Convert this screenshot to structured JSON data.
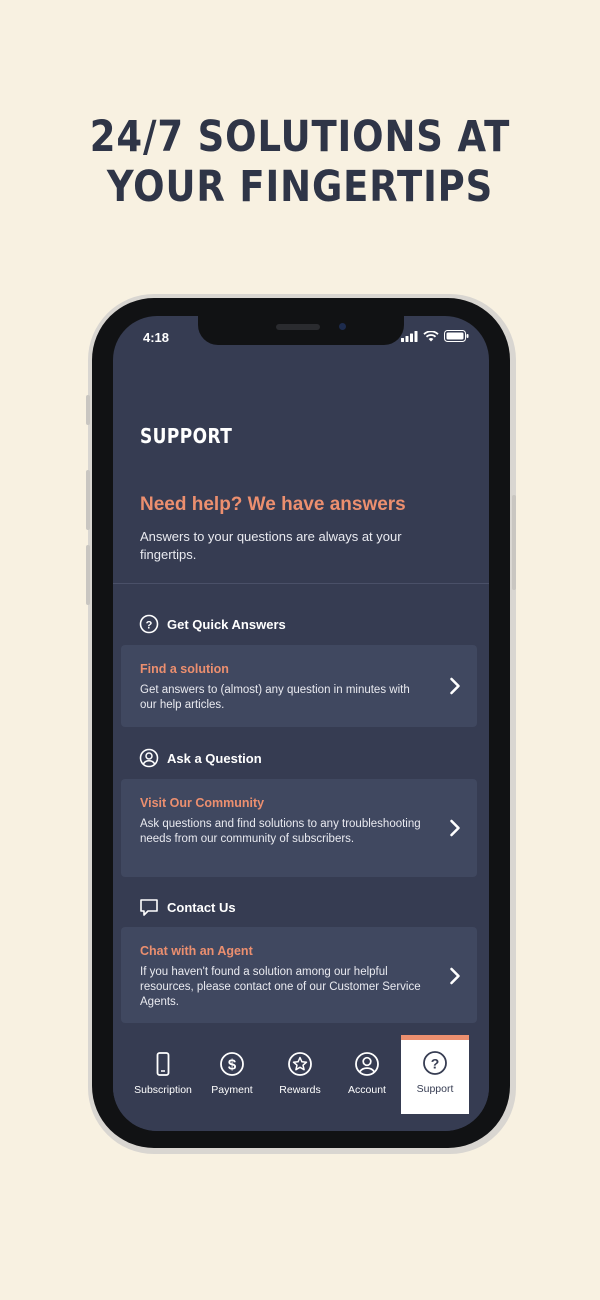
{
  "headline": {
    "line1": "24/7 SOLUTIONS AT",
    "line2": "YOUR FINGERTIPS"
  },
  "status_bar": {
    "time": "4:18"
  },
  "page": {
    "title": "SUPPORT"
  },
  "hero": {
    "heading": "Need help? We have answers",
    "text": "Answers to your questions are always at your fingertips."
  },
  "sections": [
    {
      "header": "Get Quick Answers",
      "icon": "question-circle-icon",
      "card": {
        "title": "Find a solution",
        "text": "Get answers to (almost) any question in minutes with our help articles."
      }
    },
    {
      "header": "Ask a Question",
      "icon": "user-circle-icon",
      "card": {
        "title": "Visit Our Community",
        "text": "Ask questions and find solutions to any troubleshooting needs from our community of subscribers."
      }
    },
    {
      "header": "Contact Us",
      "icon": "chat-bubble-icon",
      "card": {
        "title": "Chat with an Agent",
        "text": "If you haven't found a solution among our helpful resources, please contact one of our Customer Service Agents."
      }
    }
  ],
  "tabs": [
    {
      "label": "Subscription",
      "icon": "phone-icon"
    },
    {
      "label": "Payment",
      "icon": "dollar-circle-icon"
    },
    {
      "label": "Rewards",
      "icon": "star-circle-icon"
    },
    {
      "label": "Account",
      "icon": "user-circle-icon"
    },
    {
      "label": "Support",
      "icon": "question-circle-icon",
      "active": true
    }
  ],
  "colors": {
    "background": "#f8f1e1",
    "headline": "#2f3547",
    "screen": "#363c52",
    "card": "#404860",
    "accent": "#ec8f6f"
  }
}
